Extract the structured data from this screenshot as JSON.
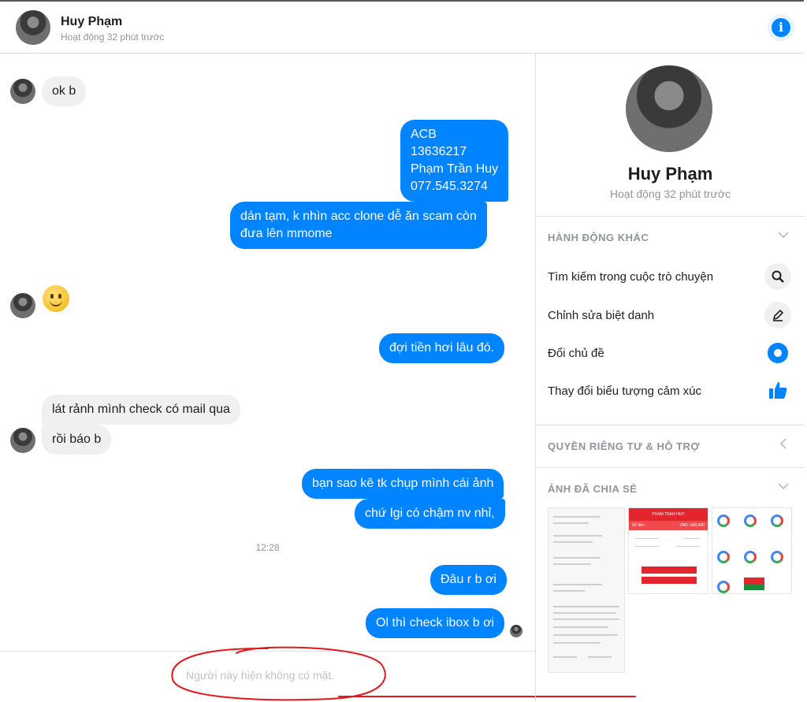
{
  "header": {
    "name": "Huy Phạm",
    "status": "Hoạt động 32 phút trước"
  },
  "messages": [
    {
      "text": "ok b"
    },
    {
      "text": "ACB\n13636217\nPhạm Trần Huy\n077.545.3274"
    },
    {
      "text": "dán tạm, k nhìn acc clone dễ ăn scam còn\nđưa lên mmome"
    },
    {
      "text": "đợi tiền hơi lâu đó."
    },
    {
      "text": "lát rảnh mình check có mail qua"
    },
    {
      "text": "rồi báo b"
    },
    {
      "text": "bạn sao kê tk chụp mình cái ảnh"
    },
    {
      "text": "chứ lgi có chậm nv nhỉ,"
    },
    {
      "text": "Đâu r b ơi"
    },
    {
      "text": "Ol thì check ibox b ơi"
    }
  ],
  "timestamp": "12:28",
  "composer": {
    "placeholder": "Người này hiện không có mặt."
  },
  "sidebar": {
    "name": "Huy Phạm",
    "status": "Hoạt động 32 phút trước",
    "sections": {
      "more_actions": "HÀNH ĐỘNG KHÁC",
      "privacy": "QUYỀN RIÊNG TƯ & HỖ TRỢ",
      "shared_photos": "ẢNH ĐÃ CHIA SẺ"
    },
    "actions": [
      {
        "label": "Tìm kiếm trong cuộc trò chuyện",
        "icon": "search-icon"
      },
      {
        "label": "Chỉnh sửa biệt danh",
        "icon": "pencil-icon"
      },
      {
        "label": "Đổi chủ đề",
        "icon": "theme-icon"
      },
      {
        "label": "Thay đổi biểu tượng cảm xúc",
        "icon": "thumbs-up-icon"
      }
    ]
  },
  "shared_photo": {
    "header": "PHAM TRAN HUY",
    "field": "Số tiền",
    "amount": "VND -400,000"
  },
  "colors": {
    "accent": "#0084ff",
    "incoming_bubble": "#f1f0f0",
    "annotation": "#e0191e"
  }
}
